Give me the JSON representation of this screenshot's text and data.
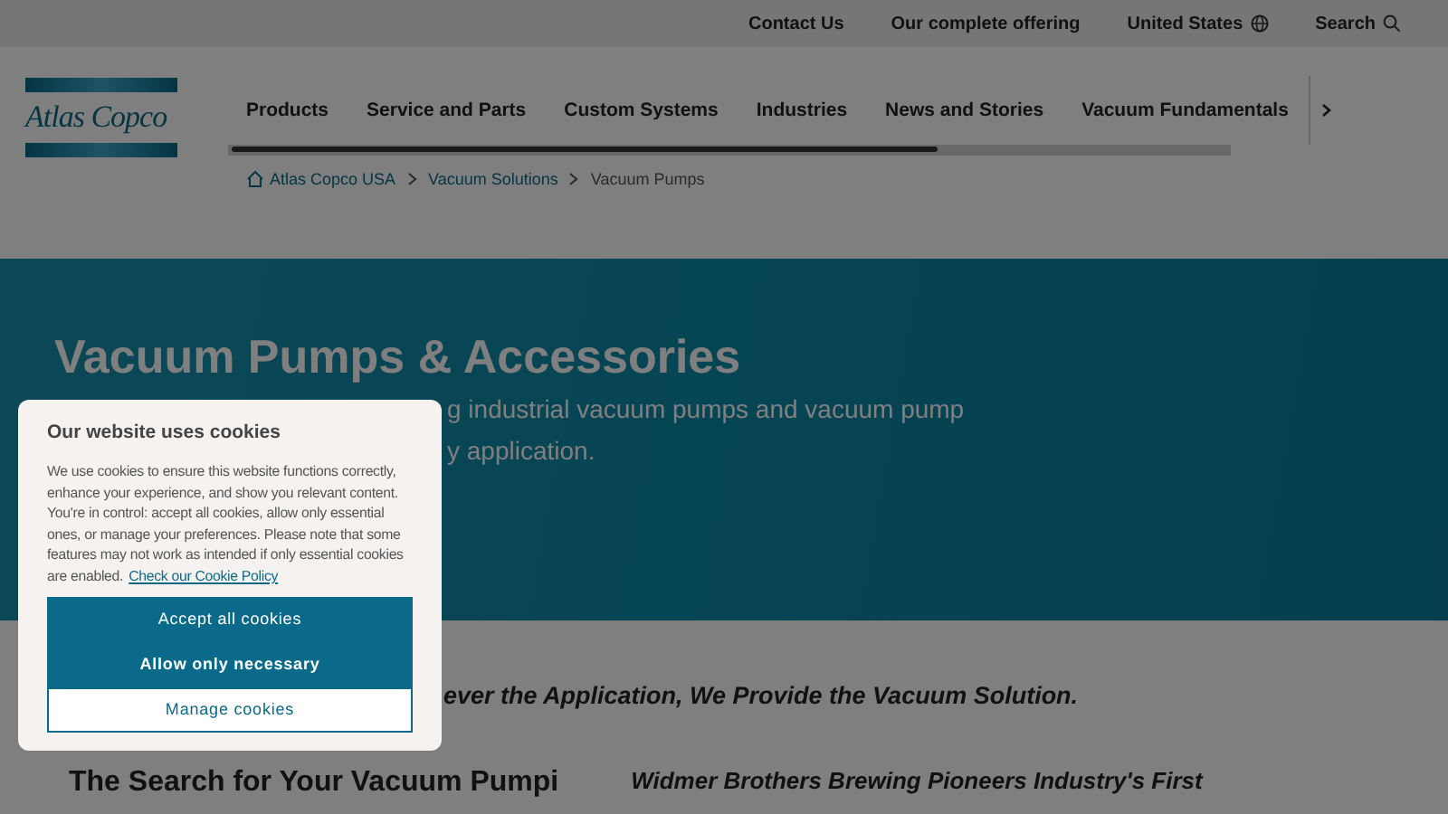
{
  "utility_bar": {
    "links": [
      "Contact Us",
      "Our complete offering",
      "United States",
      "Search"
    ]
  },
  "logo": {
    "text": "Atlas Copco"
  },
  "nav": {
    "items": [
      "Products",
      "Service and Parts",
      "Custom Systems",
      "Industries",
      "News and Stories",
      "Vacuum Fundamentals"
    ]
  },
  "breadcrumb": [
    {
      "label": "Atlas Copco USA",
      "kind": "home"
    },
    {
      "label": "Vacuum Solutions",
      "kind": "link"
    },
    {
      "label": "Vacuum Pumps",
      "kind": "current"
    }
  ],
  "hero": {
    "title": "Vacuum Pumps & Accessories",
    "subtitle_lines": [
      "g industrial vacuum pumps and vacuum pump",
      "y application."
    ]
  },
  "tagline": "ever the Application, We Provide the Vacuum Solution.",
  "section": {
    "heading": "The Search for Your Vacuum Pumpi",
    "story_title": "Widmer Brothers Brewing Pioneers Industry's First"
  },
  "cookie_dialog": {
    "title": "Our website uses cookies",
    "body": "We use cookies to ensure this website functions correctly, enhance your experience, and show you relevant content. You're in control: accept all cookies, allow only essential ones, or manage your preferences. Please note that some features may not work as intended if only essential cookies are enabled.",
    "policy_link": "Check our Cookie Policy",
    "buttons": [
      {
        "label": "Accept all cookies",
        "kind": "primary"
      },
      {
        "label": "Allow only necessary",
        "kind": "primary"
      },
      {
        "label": "Manage cookies",
        "kind": "outline"
      }
    ]
  }
}
